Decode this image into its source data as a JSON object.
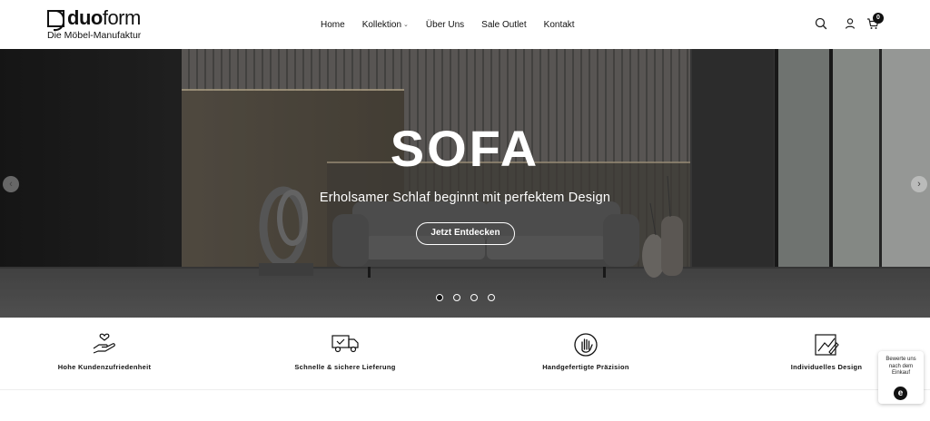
{
  "brand": {
    "word_light_part": "duo",
    "word_heavy_part": "form",
    "tagline": "Die Möbel-Manufaktur"
  },
  "nav": {
    "items": [
      {
        "label": "Home"
      },
      {
        "label": "Kollektion",
        "has_dropdown": true
      },
      {
        "label": "Über Uns"
      },
      {
        "label": "Sale Outlet"
      },
      {
        "label": "Kontakt"
      }
    ]
  },
  "header_icons": {
    "search": "search-icon",
    "account": "user-icon",
    "cart": "cart-icon",
    "cart_count": "0"
  },
  "hero": {
    "title": "SOFA",
    "subtitle": "Erholsamer Schlaf beginnt mit perfektem Design",
    "cta_label": "Jetzt Entdecken",
    "slide_count": 4,
    "active_slide": 1,
    "prev_arrow": "‹",
    "next_arrow": "›"
  },
  "features": [
    {
      "label": "Hohe Kundenzufriedenheit",
      "icon": "hand-heart-icon"
    },
    {
      "label": "Schnelle & sichere Lieferung",
      "icon": "delivery-truck-icon"
    },
    {
      "label": "Handgefertigte Präzision",
      "icon": "handmade-hand-icon"
    },
    {
      "label": "Individuelles Design",
      "icon": "design-drawing-icon"
    }
  ],
  "review_widget": {
    "text": "Bewerte uns nach dem Einkauf",
    "logo_letter": "e"
  },
  "colors": {
    "text": "#111111",
    "hero_overlay": "#2e2e2e",
    "white": "#ffffff"
  }
}
